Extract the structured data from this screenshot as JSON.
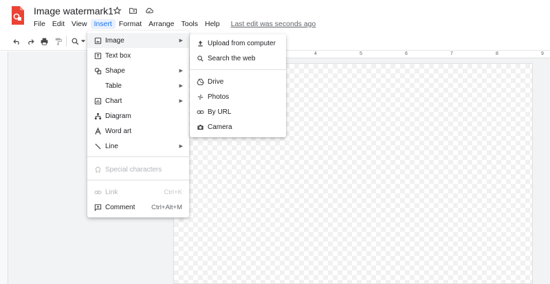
{
  "app": {
    "doc_title": "Image watermark1",
    "brand_color": "#ea4335"
  },
  "menubar": {
    "items": [
      "File",
      "Edit",
      "View",
      "Insert",
      "Format",
      "Arrange",
      "Tools",
      "Help"
    ],
    "active": "Insert",
    "last_edit": "Last edit was seconds ago"
  },
  "toolbar": {
    "icons": [
      "undo-icon",
      "redo-icon",
      "print-icon",
      "paint-format-icon",
      "zoom-icon",
      "zoom-dropdown-icon"
    ]
  },
  "ruler": {
    "numbers": [
      "4",
      "5",
      "6",
      "7",
      "8",
      "9"
    ]
  },
  "insert_menu": {
    "items": [
      {
        "label": "Image",
        "icon": "image-icon",
        "submenu": true,
        "highlighted": true
      },
      {
        "label": "Text box",
        "icon": "text-box-icon"
      },
      {
        "label": "Shape",
        "icon": "shape-icon",
        "submenu": true
      },
      {
        "label": "Table",
        "icon": "",
        "submenu": true
      },
      {
        "label": "Chart",
        "icon": "chart-icon",
        "submenu": true
      },
      {
        "label": "Diagram",
        "icon": "diagram-icon"
      },
      {
        "label": "Word art",
        "icon": "word-art-icon"
      },
      {
        "label": "Line",
        "icon": "line-icon",
        "submenu": true
      },
      {
        "label": "Special characters",
        "icon": "omega-icon",
        "disabled": true
      },
      {
        "label": "Link",
        "icon": "link-icon",
        "shortcut": "Ctrl+K",
        "disabled": true
      },
      {
        "label": "Comment",
        "icon": "comment-icon",
        "shortcut": "Ctrl+Alt+M"
      }
    ]
  },
  "image_submenu": {
    "items": [
      {
        "label": "Upload from computer",
        "icon": "upload-icon"
      },
      {
        "label": "Search the web",
        "icon": "search-icon"
      },
      {
        "label": "Drive",
        "icon": "drive-icon"
      },
      {
        "label": "Photos",
        "icon": "photos-icon"
      },
      {
        "label": "By URL",
        "icon": "link-icon"
      },
      {
        "label": "Camera",
        "icon": "camera-icon"
      }
    ]
  }
}
